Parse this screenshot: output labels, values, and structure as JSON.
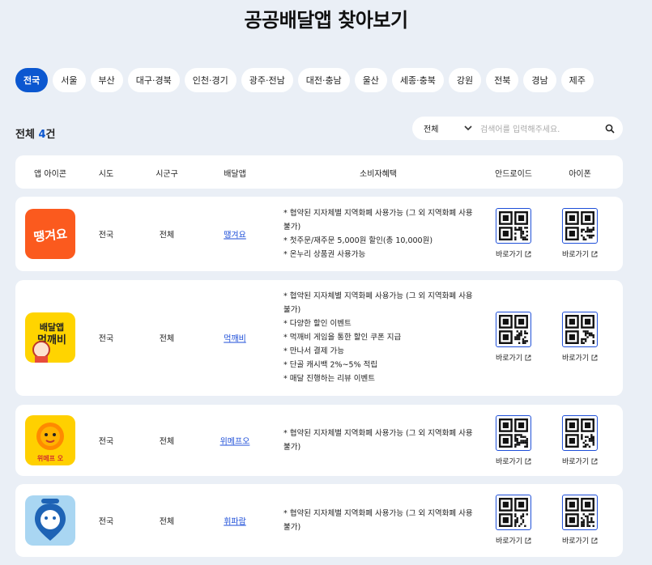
{
  "page": {
    "title": "공공배달앱 찾아보기"
  },
  "regions": [
    "전국",
    "서울",
    "부산",
    "대구·경북",
    "인천·경기",
    "광주·전남",
    "대전·충남",
    "울산",
    "세종·충북",
    "강원",
    "전북",
    "경남",
    "제주"
  ],
  "active_region": "전국",
  "summary": {
    "label": "전체",
    "count": "4",
    "unit": "건"
  },
  "search": {
    "select_value": "전체",
    "placeholder": "검색어를 입력해주세요."
  },
  "table": {
    "headers": {
      "icon": "앱 아이콘",
      "sido": "시도",
      "sigungu": "시군구",
      "app": "배달앱",
      "benefit": "소비자혜택",
      "android": "안드로이드",
      "iphone": "아이폰"
    },
    "link_label": "바로가기",
    "rows": [
      {
        "sido": "전국",
        "sigungu": "전체",
        "app": "땡겨요",
        "logo": "ddangyo-logo",
        "benefits": [
          "* 협약된 지자체별 지역화폐 사용가능 (그 외 지역화폐 사용불가)",
          "* 첫주문/재주문 5,000원 할인(총 10,000원)",
          "* 온누리 상품권 사용가능"
        ]
      },
      {
        "sido": "전국",
        "sigungu": "전체",
        "app": "먹깨비",
        "logo": "meokkaebi-logo",
        "benefits": [
          "* 협약된 지자체별 지역화폐 사용가능 (그 외 지역화폐 사용불가)",
          "* 다양한 할인 이벤트",
          "* 먹깨비 게임을 통한 할인 쿠폰 지급",
          "* 만나서 결제 가능",
          "* 단골 캐시백 2%~5% 적립",
          "* 매달 진행하는 리뷰 이벤트"
        ]
      },
      {
        "sido": "전국",
        "sigungu": "전체",
        "app": "위메프오",
        "logo": "wemakeprice-o-logo",
        "logo_text": "위메프 오",
        "benefits": [
          "* 협약된 지자체별 지역화폐 사용가능 (그 외 지역화폐 사용불가)"
        ]
      },
      {
        "sido": "전국",
        "sigungu": "전체",
        "app": "휘파람",
        "logo": "hwiparam-logo",
        "benefits": [
          "* 협약된 지자체별 지역화폐 사용가능 (그 외 지역화폐 사용불가)"
        ]
      }
    ]
  },
  "colors": {
    "background": "#eaeff6",
    "accent": "#0b57d0",
    "ddangyo": "#fb5a1e",
    "meokkaebi": "#ffd400",
    "wemakeprice": "#ffd000",
    "hwiparam": "#a9d6f2"
  }
}
